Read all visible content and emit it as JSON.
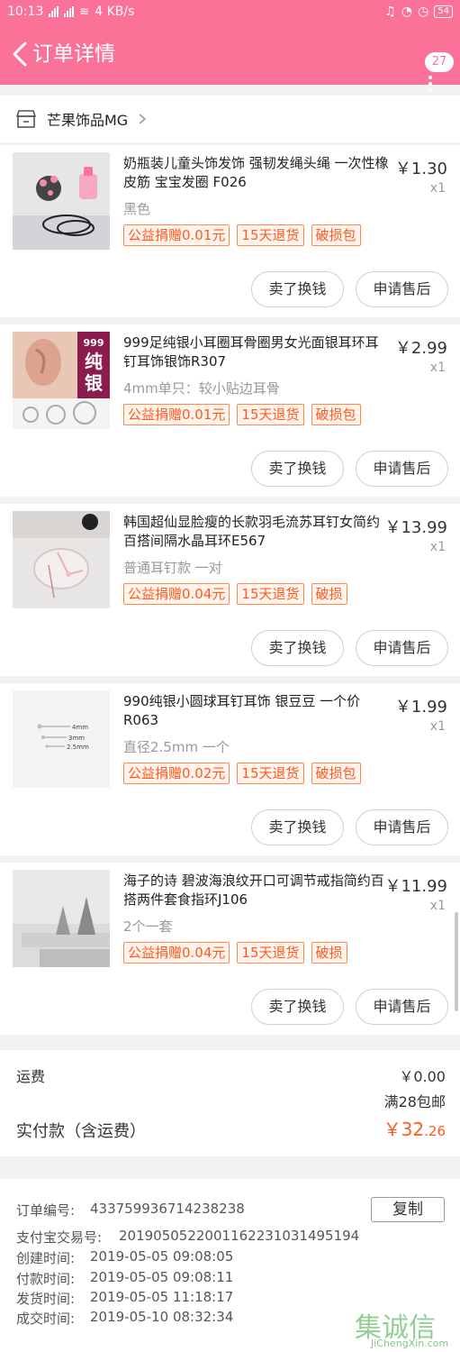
{
  "status_bar": {
    "time": "10:13",
    "speed": "4 KB/s",
    "battery": "54"
  },
  "header": {
    "title": "订单详情",
    "badge_count": "27"
  },
  "shop": {
    "name": "芒果饰品MG"
  },
  "items": [
    {
      "title": "奶瓶装儿童头饰发饰 强韧发绳头绳 一次性橡皮筋 宝宝发圈 F026",
      "price": "￥1.30",
      "qty": "x1",
      "spec": "黑色",
      "tags": [
        "公益捐赠0.01元",
        "15天退货",
        "破损包"
      ]
    },
    {
      "title": "999足纯银小耳圈耳骨圈男女光面银耳环耳钉耳饰银饰R307",
      "price": "￥2.99",
      "qty": "x1",
      "spec": "4mm单只：较小贴边耳骨",
      "tags": [
        "公益捐赠0.01元",
        "15天退货",
        "破损包"
      ],
      "thumb_text": [
        "999",
        "纯",
        "银"
      ]
    },
    {
      "title": "韩国超仙显脸瘦的长款羽毛流苏耳钉女简约百搭间隔水晶耳环E567",
      "price": "￥13.99",
      "qty": "x1",
      "spec": "普通耳钉款 一对",
      "tags": [
        "公益捐赠0.04元",
        "15天退货",
        "破损"
      ]
    },
    {
      "title": "990纯银小圆球耳钉耳饰 银豆豆 一个价R063",
      "price": "￥1.99",
      "qty": "x1",
      "spec": "直径2.5mm 一个",
      "tags": [
        "公益捐赠0.02元",
        "15天退货",
        "破损包"
      ],
      "thumb_text": [
        "4mm",
        "3mm",
        "2.5mm"
      ]
    },
    {
      "title": "海子的诗 碧波海浪纹开口可调节戒指简约百搭两件套食指环J106",
      "price": "￥11.99",
      "qty": "x1",
      "spec": "2个一套",
      "tags": [
        "公益捐赠0.04元",
        "15天退货",
        "破损"
      ]
    }
  ],
  "buttons": {
    "sell": "卖了换钱",
    "after_sale": "申请售后"
  },
  "summary": {
    "shipping_label": "运费",
    "shipping_value": "￥0.00",
    "free_shipping_note": "满28包邮",
    "paid_label": "实付款（含运费）",
    "paid_int": "￥32",
    "paid_dec": ".26"
  },
  "order_info": {
    "order_no_label": "订单编号:",
    "order_no": "433759936714238238",
    "copy_label": "复制",
    "alipay_label": "支付宝交易号:",
    "alipay_no": "2019050522001162231031495194",
    "created_label": "创建时间:",
    "created": "2019-05-05 09:08:05",
    "paid_label": "付款时间:",
    "paid": "2019-05-05 09:08:11",
    "shipped_label": "发货时间:",
    "shipped": "2019-05-05 11:18:17",
    "done_label": "成交时间:",
    "done": "2019-05-10 08:32:34"
  },
  "watermark": {
    "cn": "集诚信",
    "en": "JiChengXin.com"
  },
  "colors": {
    "brand": "#fb7299",
    "accent": "#ff5a1f"
  }
}
